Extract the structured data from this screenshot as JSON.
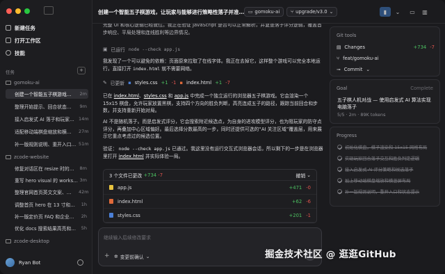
{
  "window": {
    "traffic_lights": [
      "#ff5f57",
      "#febc2e",
      "#28c840"
    ]
  },
  "sidebar": {
    "nav": [
      {
        "label": "新建任务",
        "icon": "new-task-icon"
      },
      {
        "label": "打开工作区",
        "icon": "folder-open-icon"
      },
      {
        "label": "技能",
        "icon": "skills-icon"
      }
    ],
    "tasks_label": "任务",
    "groups": [
      {
        "name": "gomoku-ai",
        "tasks": [
          {
            "title": "创建一个智能五子棋游戏…",
            "time": "2m",
            "active": true
          },
          {
            "title": "整理开始提示、回合状态…",
            "time": "9m"
          },
          {
            "title": "接入启发式 AI 落子和玩家…",
            "time": "14m"
          },
          {
            "title": "适配移动端棋盘缩放和横…",
            "time": "27m"
          },
          {
            "title": "补一版规则说明、重开入口…",
            "time": "51m"
          }
        ]
      },
      {
        "name": "zcode-website",
        "tasks": [
          {
            "title": "修复对话区在 resize 时的…",
            "time": "8m"
          },
          {
            "title": "重写 hero visual 的 works…",
            "time": "3m"
          },
          {
            "title": "整理官网首页英文文案、…",
            "time": "42m"
          },
          {
            "title": "调整首页 hero 在 13 寸和移…",
            "time": "1h"
          },
          {
            "title": "补一版定价页 FAQ 和企业…",
            "time": "2h"
          },
          {
            "title": "优化 docs 搜索结果高亮和…",
            "time": "5h"
          }
        ]
      },
      {
        "name": "zcode-desktop",
        "tasks": []
      }
    ],
    "user": {
      "name": "Ryan Bot"
    }
  },
  "topbar": {
    "title": "创建一个智能五子棋游戏，让玩家与能够进行策略性落子并准确判断胜负的AI对战",
    "repo": "gomoku-ai",
    "branch": "upgrade/v3.0"
  },
  "main": {
    "para1": "完整 UI 和核心逻辑已经就位。我正在验证 JavaScript 是否可以正常解析，并复查落子评分逻辑，覆盖首步响应、平局处理和连线胜利等边界情况。",
    "exec1_label": "已运行",
    "exec1_cmd": "node --check app.js",
    "para2_a": "我发现了一个可以避免的依赖：页面原来拉取了在线字体。我正在去掉它，这样整个游戏可以完全本地运行，直接打开 ",
    "para2_file": "index.html",
    "para2_b": " 就不需要网络。",
    "updated_label": "已更新",
    "upd_files": [
      {
        "name": "styles.css",
        "add": "+1",
        "del": "-1"
      },
      {
        "name": "index.html",
        "add": "+1",
        "del": "-7"
      }
    ],
    "para3_a": "已在 ",
    "para3_f1": "index.html",
    "para3_sep1": "、",
    "para3_f2": "styles.css",
    "para3_sep2": " 和 ",
    "para3_f3": "app.js",
    "para3_b": " 中完成一个独立运行的浏览器五子棋游戏。它会渲染一个 15x15 棋盘，允许玩家放置黑棋，支持四个方向的胜负判断，高亮连成五子的路径，跟踪当前回合和步数，并支持重新开始对局。",
    "para4": "AI 不是随机落子。而是启发式评分，它会搜索附近候选点，为自身的进攻模型评分，也为阻玩家的防守点评分，再叠加中心区域偏好。最后选择分数最高的一步，同时还提供可选的“AI 关注区域”覆盖层，用来展示它重点考虑过的候选位置。",
    "para5_a": "验证：  ",
    "para5_cmd": "node --check app.js",
    "para5_b": " 已通过。我这里没有运行交互式浏览器会话，所以剩下的一步是在浏览器里打开 ",
    "para5_file": "index.html",
    "para5_c": " 并实际体验一局。",
    "changes": {
      "header": "3 个文件已更改",
      "add": "+734",
      "del": "-7",
      "revert": "撤销",
      "files": [
        {
          "name": "app.js",
          "add": "+471",
          "del": "-0",
          "color": "#e8c33f"
        },
        {
          "name": "index.html",
          "add": "+62",
          "del": "-6",
          "color": "#e06a3a"
        },
        {
          "name": "styles.css",
          "add": "+201",
          "del": "-1",
          "color": "#4b7fd6"
        }
      ]
    },
    "composer": {
      "placeholder": "继续输入后续修改要求",
      "mode": "变更前确认"
    }
  },
  "right": {
    "git_title": "Git tools",
    "changes_label": "Changes",
    "changes_add": "+734",
    "changes_del": "-7",
    "branch": "feat/gomoku-ai",
    "commit": "Commit",
    "goal_label": "Goal",
    "goal_status": "Complete",
    "goal_title": "五子棋人机对战 — 使用启发式 AI 算法实现电脑落子",
    "goal_meta": "5/5 · 2m · 89K tokens",
    "progress_label": "Progress",
    "progress": [
      "初始化棋盘，棋子渲染和 15x15 网格布局",
      "实现玩家回合落子交互和胜负判定逻辑",
      "接入启发式 AI 评分策略和候选落子",
      "加上移动端棋盘缩放和横竖屏布局",
      "补一版规则说明，重开入口和状态提示"
    ]
  },
  "watermark": "掘金技术社区 @ 逛逛GitHub"
}
